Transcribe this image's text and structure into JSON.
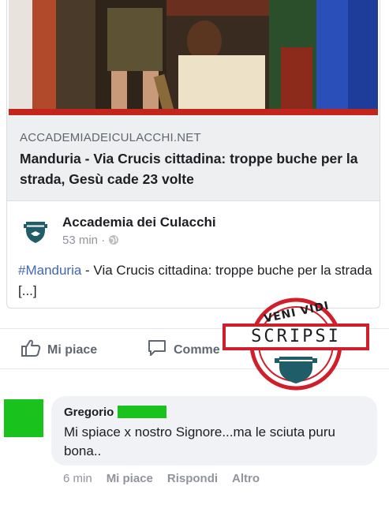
{
  "post": {
    "link_domain": "ACCADEMIADEICULACCHI.NET",
    "link_title": "Manduria - Via Crucis cittadina: troppe buche per la strada, Gesù cade 23 volte",
    "page_name": "Accademia dei Culacchi",
    "time": "53 min",
    "separator": "·",
    "hashtag": "#Manduria",
    "text": " - Via Crucis cittadina: troppe buche per la strada [...]"
  },
  "actions": {
    "like_label": "Mi piace",
    "comment_label": "Comme"
  },
  "comment": {
    "author": "Gregorio",
    "text": "Mi spiace x nostro Signore...ma le sciuta puru bona..",
    "time": "6 min",
    "like_label": "Mi piace",
    "reply_label": "Rispondi",
    "more_label": "Altro"
  },
  "stamp": {
    "top_text": "VENI VIDI",
    "main_text": "SCRIPSI"
  },
  "colors": {
    "hashtag": "#4267b2",
    "redaction": "#19c21c",
    "stamp_red": "#d01f2a"
  }
}
